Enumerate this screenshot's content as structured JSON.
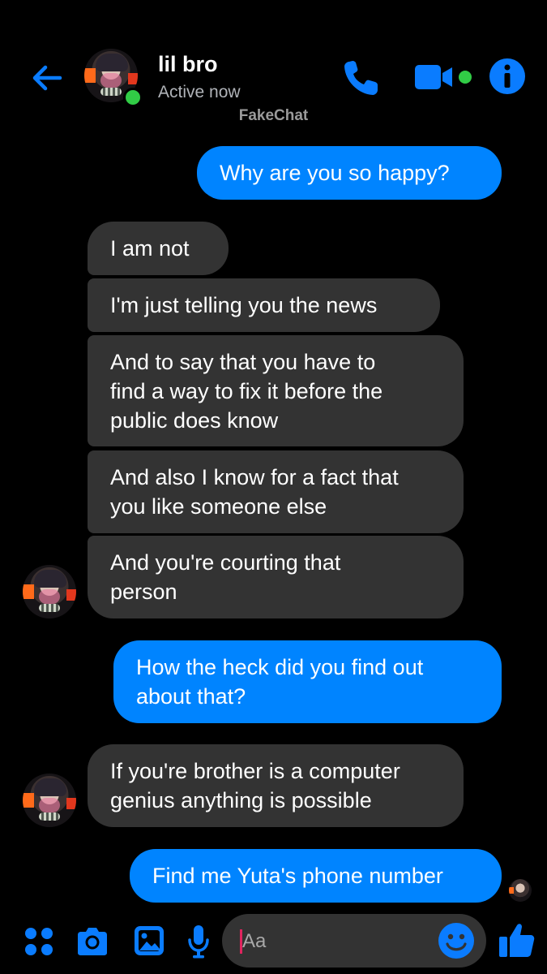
{
  "header": {
    "contact_name": "lil bro",
    "status": "Active now",
    "watermark": "FakeChat",
    "icons": {
      "back": "back-arrow-icon",
      "call": "phone-icon",
      "video": "video-camera-icon",
      "info": "info-icon"
    },
    "online": true
  },
  "messages": [
    {
      "side": "sent",
      "lines": [
        "Why are you so happy?"
      ]
    },
    {
      "side": "received",
      "lines": [
        "I am not"
      ]
    },
    {
      "side": "received",
      "lines": [
        "I'm just telling you the news"
      ]
    },
    {
      "side": "received",
      "lines": [
        "And to say that you have to",
        "find a way to fix it before the",
        "public does know"
      ]
    },
    {
      "side": "received",
      "lines": [
        "And also I know for a fact that",
        "you like someone else"
      ]
    },
    {
      "side": "received",
      "lines": [
        "And you're courting that",
        "person"
      ]
    },
    {
      "side": "sent",
      "lines": [
        "How the heck did you find out",
        "about that?"
      ]
    },
    {
      "side": "received",
      "lines": [
        "If you're brother is a computer",
        "genius anything is possible"
      ]
    },
    {
      "side": "sent",
      "lines": [
        "Find me Yuta's phone number"
      ]
    }
  ],
  "composer": {
    "placeholder": "Aa",
    "icons": [
      "apps-icon",
      "camera-icon",
      "gallery-icon",
      "microphone-icon",
      "emoji-icon",
      "thumbs-up-icon"
    ]
  },
  "colors": {
    "accent": "#0084ff",
    "sent_bubble": "#0084ff",
    "received_bubble": "#333333",
    "background": "#000000",
    "online": "#31cc46"
  }
}
